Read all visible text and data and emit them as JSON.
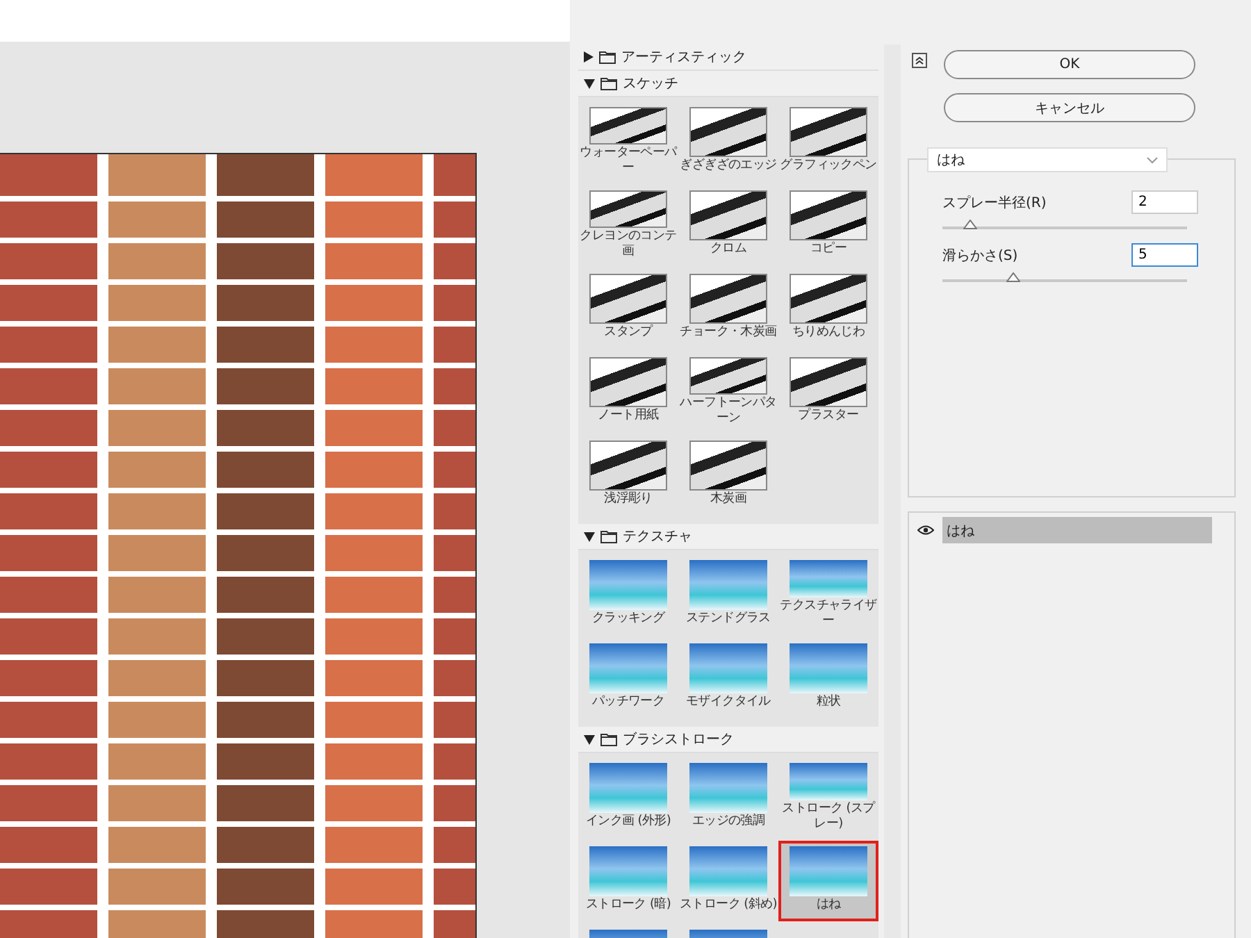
{
  "categories": [
    {
      "name": "アーティスティック",
      "expanded": false
    },
    {
      "name": "スケッチ",
      "kind": "mono",
      "expanded": true,
      "items": [
        {
          "label": "ウォーターペーパー",
          "selected": false
        },
        {
          "label": "ぎざぎざのエッジ",
          "selected": false
        },
        {
          "label": "グラフィックペン",
          "selected": false
        },
        {
          "label": "クレヨンのコンテ画",
          "selected": false
        },
        {
          "label": "クロム",
          "selected": false
        },
        {
          "label": "コピー",
          "selected": false
        },
        {
          "label": "スタンプ",
          "selected": false
        },
        {
          "label": "チョーク・木炭画",
          "selected": false
        },
        {
          "label": "ちりめんじわ",
          "selected": false
        },
        {
          "label": "ノート用紙",
          "selected": false
        },
        {
          "label": "ハーフトーンパターン",
          "selected": false
        },
        {
          "label": "プラスター",
          "selected": false
        },
        {
          "label": "浅浮彫り",
          "selected": false
        },
        {
          "label": "木炭画",
          "selected": false
        }
      ]
    },
    {
      "name": "テクスチャ",
      "kind": "color",
      "expanded": true,
      "items": [
        {
          "label": "クラッキング",
          "selected": false
        },
        {
          "label": "ステンドグラス",
          "selected": false
        },
        {
          "label": "テクスチャライザー",
          "selected": false
        },
        {
          "label": "パッチワーク",
          "selected": false
        },
        {
          "label": "モザイクタイル",
          "selected": false
        },
        {
          "label": "粒状",
          "selected": false
        }
      ]
    },
    {
      "name": "ブラシストローク",
      "kind": "color",
      "expanded": true,
      "items": [
        {
          "label": "インク画 (外形)",
          "selected": false
        },
        {
          "label": "エッジの強調",
          "selected": false
        },
        {
          "label": "ストローク (スプレー)",
          "selected": false
        },
        {
          "label": "ストローク (暗)",
          "selected": false
        },
        {
          "label": "ストローク (斜め)",
          "selected": false
        },
        {
          "label": "はね",
          "selected": true
        },
        {
          "selected": false
        },
        {
          "selected": false
        }
      ]
    }
  ],
  "buttons": [
    "OK",
    "キャンセル"
  ],
  "filter_select": {
    "value": "はね"
  },
  "settings": [
    {
      "label": "スプレー半径(R)",
      "value": "2",
      "focused": false,
      "level": 0.09
    },
    {
      "label": "滑らかさ(S)",
      "value": "5",
      "focused": true,
      "level": 0.28
    }
  ],
  "layers": [
    {
      "name": "はね",
      "visible": true,
      "selected": true
    }
  ]
}
